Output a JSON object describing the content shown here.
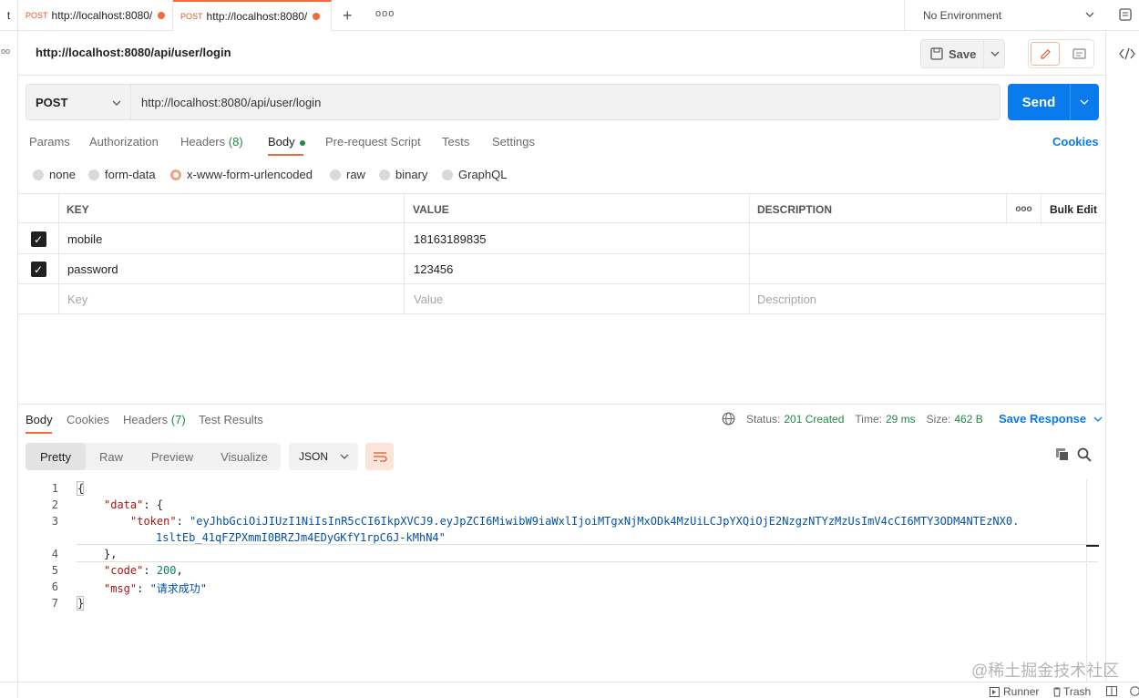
{
  "tabs": {
    "partial_label": "t",
    "items": [
      {
        "method": "POST",
        "url": "http://localhost:8080/"
      },
      {
        "method": "POST",
        "url": "http://localhost:8080/"
      }
    ],
    "overflow": "ooo"
  },
  "environment": {
    "label": "No Environment"
  },
  "left_rail": {
    "glyph": "oo"
  },
  "request": {
    "title": "http://localhost:8080/api/user/login",
    "save_label": "Save",
    "method": "POST",
    "url": "http://localhost:8080/api/user/login",
    "send_label": "Send"
  },
  "subtabs": {
    "params": "Params",
    "authorization": "Authorization",
    "headers": "Headers",
    "headers_count": "(8)",
    "body": "Body",
    "prerequest": "Pre-request Script",
    "tests": "Tests",
    "settings": "Settings",
    "cookies": "Cookies"
  },
  "body_types": {
    "none": "none",
    "form_data": "form-data",
    "urlencoded": "x-www-form-urlencoded",
    "raw": "raw",
    "binary": "binary",
    "graphql": "GraphQL"
  },
  "table": {
    "col_key": "KEY",
    "col_value": "VALUE",
    "col_description": "DESCRIPTION",
    "more": "ooo",
    "bulk_edit": "Bulk Edit",
    "rows": [
      {
        "key": "mobile",
        "value": "18163189835",
        "checked": true
      },
      {
        "key": "password",
        "value": "123456",
        "checked": true
      }
    ],
    "placeholder_key": "Key",
    "placeholder_value": "Value",
    "placeholder_description": "Description"
  },
  "response": {
    "tabs": {
      "body": "Body",
      "cookies": "Cookies",
      "headers": "Headers",
      "headers_count": "(7)",
      "test_results": "Test Results"
    },
    "status_label": "Status:",
    "status_value": "201 Created",
    "time_label": "Time:",
    "time_value": "29 ms",
    "size_label": "Size:",
    "size_value": "462 B",
    "save_response": "Save Response",
    "views": {
      "pretty": "Pretty",
      "raw": "Raw",
      "preview": "Preview",
      "visualize": "Visualize"
    },
    "format": "JSON",
    "lines": [
      "1",
      "2",
      "3",
      "4",
      "5",
      "6",
      "7"
    ],
    "json": {
      "open_brace": "{",
      "data_key": "\"data\"",
      "token_key": "\"token\"",
      "token_part1": "\"eyJhbGciOiJIUzI1NiIsInR5cCI6IkpXVCJ9.eyJpZCI6MiwibW9iaWxlIjoiMTgxNjMxODk4MzUiLCJpYXQiOjE2NzgzNTYzMzUsImV4cCI6MTY3ODM4NTEzNX0.",
      "token_part2": "1sltEb_41qFZPXmmI0BRZJm4EDyGKfY1rpC6J-kMhN4\"",
      "close_data": "},",
      "code_key": "\"code\"",
      "code_value": "200",
      "msg_key": "\"msg\"",
      "msg_value": "\"请求成功\"",
      "close_brace": "}"
    }
  },
  "footer": {
    "runner": "Runner",
    "trash": "Trash",
    "watermark": "@稀土掘金技术社区"
  },
  "colors": {
    "accent": "#f26b3a",
    "send": "#097bed",
    "status_ok": "#1e8a44",
    "link": "#097bed"
  }
}
